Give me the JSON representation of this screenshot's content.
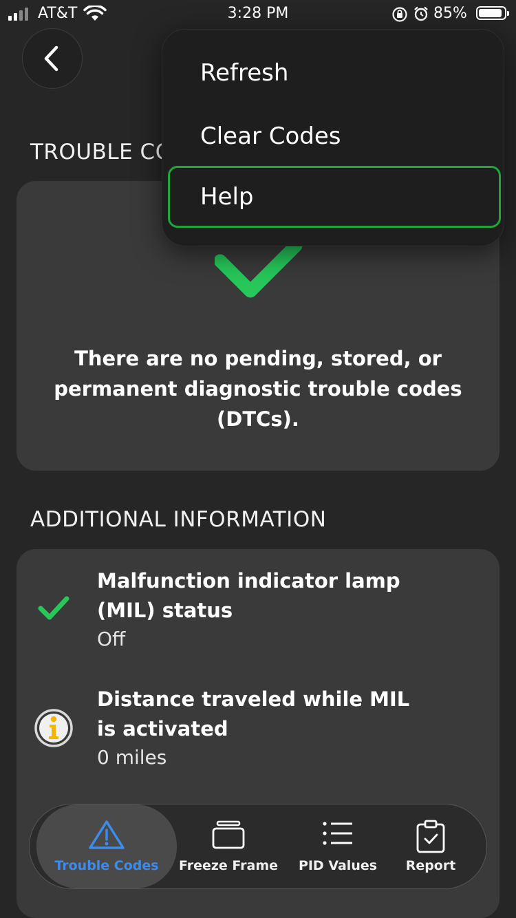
{
  "status_bar": {
    "carrier": "AT&T",
    "time": "3:28 PM",
    "battery_percent": "85%"
  },
  "sections": {
    "trouble_codes_title": "TROUBLE CODES",
    "trouble_codes_title_visible": "TROUBLE CO",
    "dtc_message": "There are no pending, stored, or permanent diagnostic trouble codes (DTCs).",
    "additional_info_title": "ADDITIONAL INFORMATION"
  },
  "info_items": [
    {
      "title": "Malfunction indicator lamp (MIL) status",
      "value": "Off",
      "icon": "green-check-icon"
    },
    {
      "title": "Distance traveled while MIL is activated",
      "value": "0 miles",
      "icon": "info-icon"
    }
  ],
  "menu": {
    "items": [
      {
        "label": "Refresh"
      },
      {
        "label": "Clear Codes"
      },
      {
        "label": "Help"
      }
    ]
  },
  "tab_bar": {
    "tabs": [
      {
        "label": "Trouble Codes",
        "icon": "warning-triangle-icon",
        "active": true
      },
      {
        "label": "Freeze Frame",
        "icon": "stacked-frames-icon",
        "active": false
      },
      {
        "label": "PID Values",
        "icon": "list-icon",
        "active": false
      },
      {
        "label": "Report",
        "icon": "clipboard-check-icon",
        "active": false
      }
    ]
  },
  "colors": {
    "accent_green": "#1fa53a",
    "check_green": "#27c75a",
    "tab_active_blue": "#3d8bea",
    "info_yellow": "#f2b705"
  }
}
